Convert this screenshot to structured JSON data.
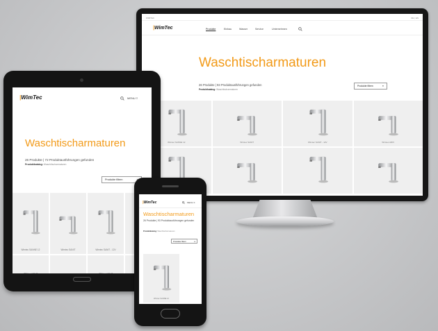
{
  "brand": {
    "logo_text": "WimTec",
    "accent_color": "#f29a18"
  },
  "page": {
    "title": "Waschtischarmaturen",
    "result_summary": "26 Produkte | 72 Produktausführungen gefunden",
    "results_desktop": "26 Produkte | 93 Produktausführungen gefunden",
    "results_tablet": "26 Produkte | 72 Produktausführungen gefunden",
    "results_phone": "26 Produkte | 93 Produktausführungen gefunden",
    "active_filter_label": "Produktkatalog:",
    "active_filter_value": "Waschtischarmaturen",
    "filter_button": "Produkte filtern"
  },
  "desktop": {
    "topbar_left": "WIMTEC",
    "topbar_right": "DE | EN",
    "nav": [
      "Produkte",
      "Einbau",
      "Wasser",
      "Service",
      "Unternehmen"
    ],
    "products": [
      "Wimtec SANNE 12",
      "Wimtec SANIT",
      "Wimtec SANIT - 12V",
      "Wimtec ARIX",
      "",
      "",
      "",
      ""
    ]
  },
  "tablet": {
    "menu_label": "MENU",
    "products": [
      "Wimtec SANNE 12",
      "Wimtec SANIT",
      "Wimtec SANIT - 12V",
      "Wimtec AR",
      "",
      "",
      "",
      ""
    ]
  },
  "phone": {
    "menu_label": "MENU",
    "products": [
      "Wimtec SANNE 12"
    ]
  },
  "icons": {
    "search": "search-icon",
    "filter": "filter-icon",
    "menu": "hamburger-icon"
  }
}
